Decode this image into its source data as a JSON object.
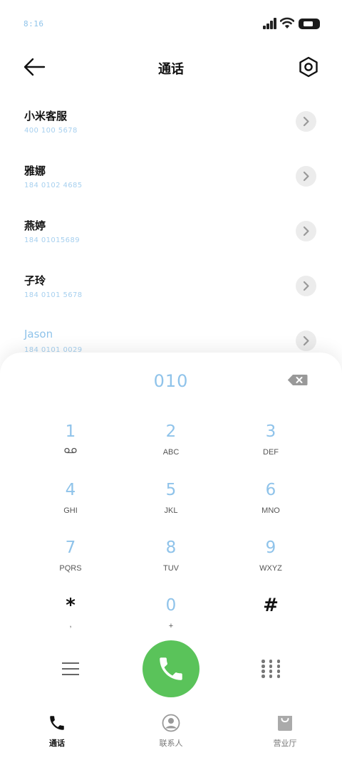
{
  "status_bar": {
    "time": "8:16",
    "icons": [
      "signal-icon",
      "wifi-icon",
      "battery-icon"
    ]
  },
  "header": {
    "title": "通话",
    "back_icon": "arrow-left-icon",
    "settings_icon": "hexagon-settings-icon"
  },
  "contacts": [
    {
      "name": "小米客服",
      "number": "400 100 5678"
    },
    {
      "name": "雅娜",
      "number": "184 0102 4685"
    },
    {
      "name": "燕婷",
      "number": "184 01015689"
    },
    {
      "name": "子玲",
      "number": "184 0101 5678"
    },
    {
      "name": "Jason",
      "number": "184 0101 0029"
    }
  ],
  "dialer": {
    "input": "010",
    "keys": [
      {
        "digit": "1",
        "letters": ""
      },
      {
        "digit": "2",
        "letters": "ABC"
      },
      {
        "digit": "3",
        "letters": "DEF"
      },
      {
        "digit": "4",
        "letters": "GHI"
      },
      {
        "digit": "5",
        "letters": "JKL"
      },
      {
        "digit": "6",
        "letters": "MNO"
      },
      {
        "digit": "7",
        "letters": "PQRS"
      },
      {
        "digit": "8",
        "letters": "TUV"
      },
      {
        "digit": "9",
        "letters": "WXYZ"
      },
      {
        "digit": "*",
        "letters": ","
      },
      {
        "digit": "0",
        "letters": "+"
      },
      {
        "digit": "#",
        "letters": ""
      }
    ]
  },
  "tabs": [
    {
      "label": "通话",
      "icon": "phone-icon",
      "active": true
    },
    {
      "label": "联系人",
      "icon": "contact-icon",
      "active": false
    },
    {
      "label": "营业厅",
      "icon": "shopping-bag-icon",
      "active": false
    }
  ],
  "colors": {
    "accent": "#8fc3ea",
    "call_green": "#5ac35a"
  }
}
